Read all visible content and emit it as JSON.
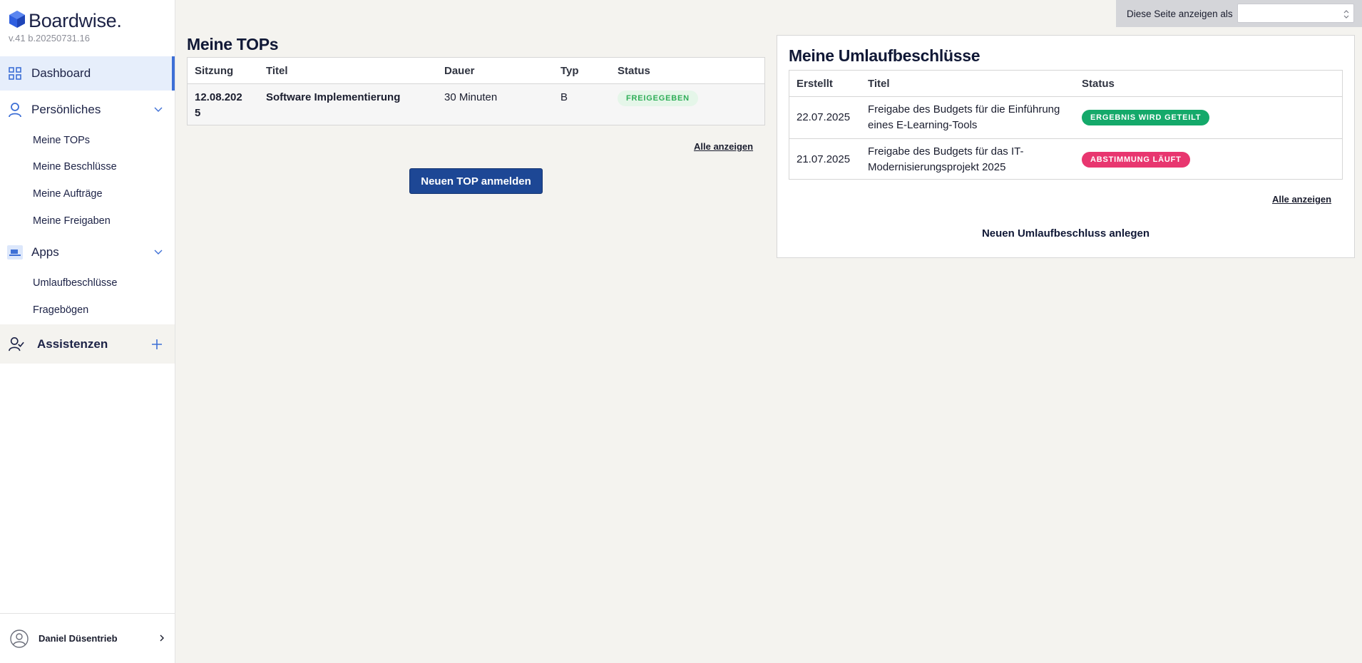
{
  "app": {
    "brand": "Boardwise.",
    "version": "v.41 b.20250731.16"
  },
  "sidebar": {
    "dashboard": "Dashboard",
    "personal": {
      "label": "Persönliches",
      "items": [
        "Meine TOPs",
        "Meine Beschlüsse",
        "Meine Aufträge",
        "Meine Freigaben"
      ]
    },
    "apps": {
      "label": "Apps",
      "items": [
        "Umlaufbeschlüsse",
        "Fragebögen"
      ]
    },
    "assistants": "Assistenzen",
    "user": "Daniel Düsentrieb"
  },
  "viewas": {
    "label": "Diese Seite anzeigen als",
    "value": ""
  },
  "tops": {
    "title": "Meine TOPs",
    "columns": [
      "Sitzung",
      "Titel",
      "Dauer",
      "Typ",
      "Status"
    ],
    "rows": [
      {
        "session_line1": "12.08.202",
        "session_line2": "5",
        "title": "Software Implementierung",
        "duration": "30 Minuten",
        "type": "B",
        "status": "FREIGEGEBEN"
      }
    ],
    "show_all": "Alle anzeigen",
    "new_button": "Neuen TOP anmelden"
  },
  "umlauf": {
    "title": "Meine Umlaufbeschlüsse",
    "columns": [
      "Erstellt",
      "Titel",
      "Status"
    ],
    "rows": [
      {
        "created": "22.07.2025",
        "title_line1": "Freigabe des Budgets für die Einführung",
        "title_line2": "eines E-Learning-Tools",
        "status": "ERGEBNIS WIRD GETEILT"
      },
      {
        "created": "21.07.2025",
        "title_line1": "Freigabe des Budgets für das IT-",
        "title_line2": "Modernisierungsprojekt 2025",
        "status": "ABSTIMMUNG LÄUFT"
      }
    ],
    "show_all": "Alle anzeigen",
    "new_button": "Neuen Umlaufbeschluss anlegen"
  },
  "colors": {
    "accent": "#3d6fd6",
    "primary_button": "#1d4795",
    "badge_green": "#14a96a",
    "badge_pink": "#e8366f",
    "badge_approved_text": "#2fae58"
  }
}
